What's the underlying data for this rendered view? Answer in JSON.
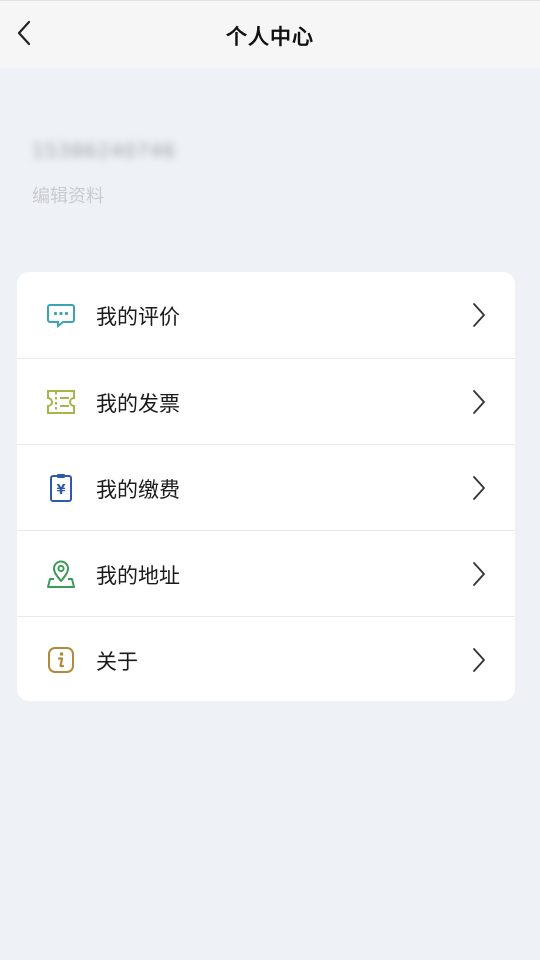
{
  "header": {
    "title": "个人中心",
    "back_icon": "chevron-left-icon"
  },
  "profile": {
    "phone": "15386240746",
    "edit_label": "编辑资料"
  },
  "menu": {
    "items": [
      {
        "label": "我的评价",
        "icon": "comment-icon",
        "color": "#3aa3b4"
      },
      {
        "label": "我的发票",
        "icon": "ticket-icon",
        "color": "#a9b54a"
      },
      {
        "label": "我的缴费",
        "icon": "payment-icon",
        "color": "#2f5aa8"
      },
      {
        "label": "我的地址",
        "icon": "location-icon",
        "color": "#3e9b57"
      },
      {
        "label": "关于",
        "icon": "info-icon",
        "color": "#b08a3a"
      }
    ],
    "chevron_icon": "chevron-right-icon"
  },
  "colors": {
    "background": "#eef1f5",
    "card": "#ffffff",
    "header": "#f6f6f6"
  }
}
